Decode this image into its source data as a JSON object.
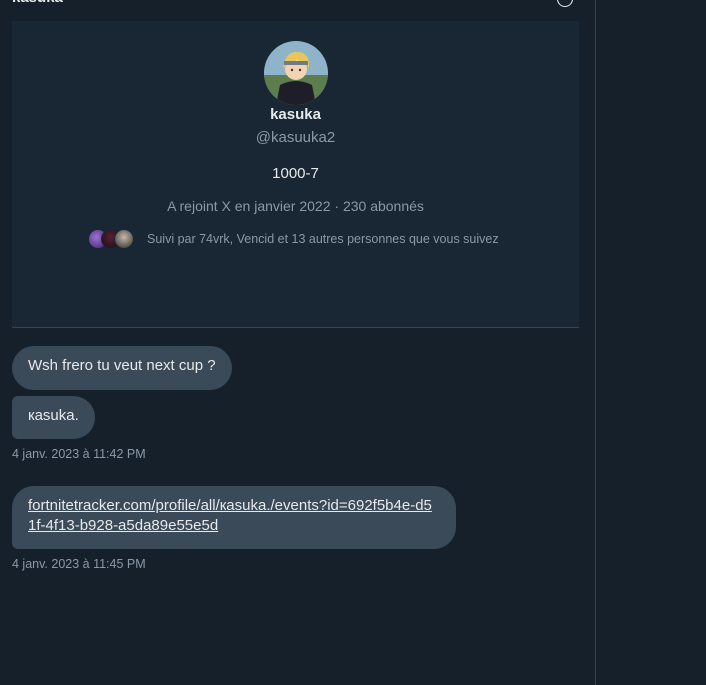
{
  "header": {
    "title": "kasuka",
    "info_icon": "info-icon"
  },
  "profile": {
    "display_name": "kasuka",
    "handle": "@kasuuka2",
    "bio": "1000-7",
    "meta": "A rejoint X en janvier 2022 · 230 abonnés",
    "followed_by": "Suivi par 74vrk, Vencid et 13 autres personnes que vous suivez"
  },
  "messages": [
    {
      "text": "Wsh frero tu veut next cup ?"
    },
    {
      "text": "кasuka."
    },
    {
      "link": "fortnitetracker.com/profile/all/кasuka./events?id=692f5b4e-d51f-4f13-b928-a5da89e55e5d"
    }
  ],
  "timestamps": [
    "4 janv. 2023 à 11:42 PM",
    "4 janv. 2023 à 11:45 PM"
  ],
  "colors": {
    "background": "#15202b",
    "card": "#192734",
    "bubble": "#3a4a58",
    "muted_text": "#8b98a5",
    "border": "#38444d"
  }
}
